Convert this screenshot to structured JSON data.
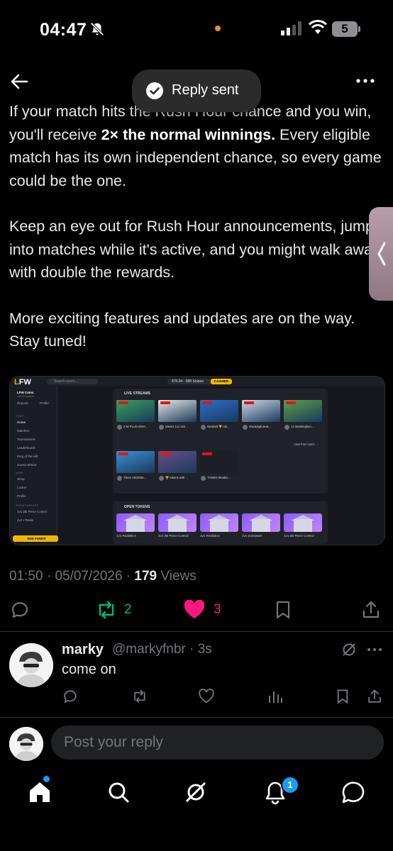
{
  "status_bar": {
    "time": "04:47",
    "battery": "5"
  },
  "toast": {
    "text": "Reply sent"
  },
  "post": {
    "paragraphs": [
      {
        "before": "If your match hits the Rush Hour chance and you win, you'll receive ",
        "bold": "2× the normal winnings.",
        "after": " Every eligible match has its own independent chance, so every game could be the one."
      },
      {
        "before": "Keep an eye out for Rush Hour announcements, jump into matches while it's active, and you might walk away with double the rewards.",
        "bold": "",
        "after": ""
      },
      {
        "before": "More exciting features and updates are on the way. Stay tuned!",
        "bold": "",
        "after": ""
      }
    ],
    "meta": {
      "time": "01:50",
      "date": "05/07/2026",
      "views_count": "179",
      "views_label": "Views"
    },
    "actions": {
      "reposts": "2",
      "likes": "3"
    },
    "embedded_image": {
      "logo_a": "L",
      "logo_b": "FW",
      "search_placeholder": "Search users...",
      "balance": "476.04 · 988 Snipes",
      "cashier": "CASHIER",
      "account_name": "LFW Coins",
      "account_sub": "476.04 balance",
      "deposit": "Deposit",
      "profile": "Profile",
      "sidebar_sections": [
        "START",
        "MORE",
        "RECENT MATCHES"
      ],
      "sidebar_items": [
        "Home",
        "Matches",
        "Tournaments",
        "Leaderboard",
        "King of the Hill",
        "Guess Where",
        "Shop",
        "Locker",
        "Profile"
      ],
      "recent_matches": [
        "1v1 ZB Piece Control",
        "2v2 • Reals"
      ],
      "add_funds": "ADD FUNDS",
      "live_streams_title": "LIVE STREAMS",
      "streams": [
        "2 NI PLUS ENVI...",
        "tokens 1v1 2v2...",
        "Newbell 🏆 tok...",
        "Wookingfumok...",
        "1z Wookingfum...",
        "Token 15/25/35...",
        "🏆 tokens with ...",
        "TOKEN Wookin..."
      ],
      "view_more": "View that match →",
      "open_tokens_title": "OPEN TOKENS",
      "tokens": [
        "1v1 Realistics",
        "2v2 ZB Piece Control",
        "1v1 Realistics",
        "1v1 Zonewars",
        "1v1 ZB Piece Control"
      ]
    }
  },
  "reply": {
    "name": "marky",
    "handle": "@markyfnbr · 3s",
    "text": "come on"
  },
  "compose": {
    "placeholder": "Post your reply"
  },
  "nav": {
    "notifications_badge": "1"
  }
}
